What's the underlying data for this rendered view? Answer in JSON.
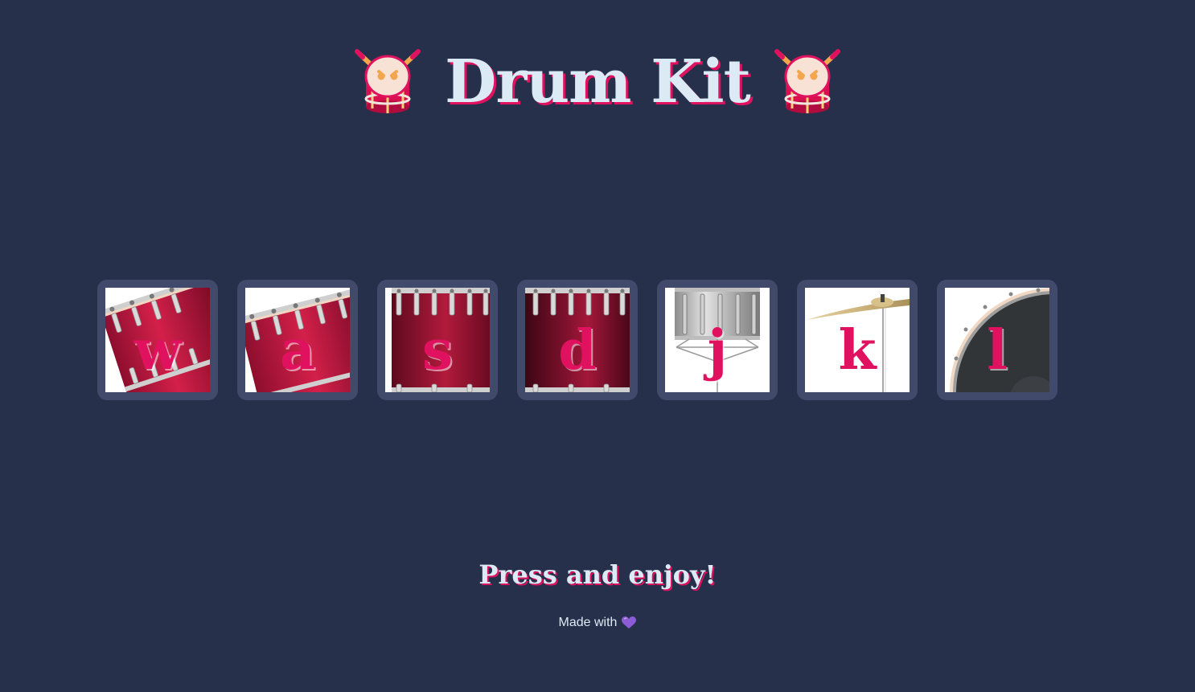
{
  "header": {
    "title": "Drum Kit",
    "left_icon": "drum-emoji-icon",
    "right_icon": "drum-emoji-icon"
  },
  "keys": [
    {
      "letter": "w",
      "instrument": "tom-1-icon"
    },
    {
      "letter": "a",
      "instrument": "tom-2-icon"
    },
    {
      "letter": "s",
      "instrument": "tom-3-icon"
    },
    {
      "letter": "d",
      "instrument": "tom-4-icon"
    },
    {
      "letter": "j",
      "instrument": "snare-icon"
    },
    {
      "letter": "k",
      "instrument": "crash-cymbal-icon"
    },
    {
      "letter": "l",
      "instrument": "kick-drum-icon"
    }
  ],
  "footer": {
    "tagline": "Press and enjoy!",
    "credit_text": "Made with",
    "credit_icon": "purple-heart-icon"
  },
  "colors": {
    "background": "#27304a",
    "key_frame": "#414a6a",
    "accent": "#e0115f",
    "title_text": "#dbeaf5",
    "heart": "#8b5cd6"
  }
}
